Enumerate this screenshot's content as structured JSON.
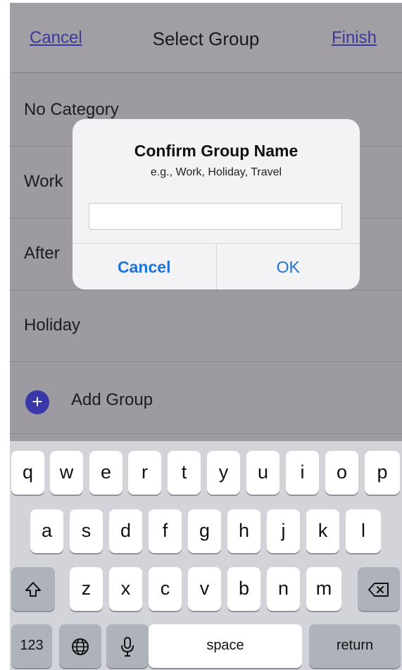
{
  "navbar": {
    "cancel_label": "Cancel",
    "title": "Select Group",
    "finish_label": "Finish"
  },
  "list": {
    "items": [
      {
        "label": "No Category"
      },
      {
        "label": "Work"
      },
      {
        "label": "After"
      },
      {
        "label": "Holiday"
      }
    ],
    "add_group_label": "Add Group",
    "add_icon": "plus-circle-icon"
  },
  "dialog": {
    "title": "Confirm Group Name",
    "subtitle": "e.g., Work, Holiday, Travel",
    "input_value": "",
    "cancel_label": "Cancel",
    "ok_label": "OK"
  },
  "keyboard": {
    "row1": [
      "q",
      "w",
      "e",
      "r",
      "t",
      "y",
      "u",
      "i",
      "o",
      "p"
    ],
    "row2": [
      "a",
      "s",
      "d",
      "f",
      "g",
      "h",
      "j",
      "k",
      "l"
    ],
    "row3": [
      "z",
      "x",
      "c",
      "v",
      "b",
      "n",
      "m"
    ],
    "numbers_label": "123",
    "space_label": "space",
    "return_label": "return",
    "shift_icon": "shift-icon",
    "backspace_icon": "backspace-icon",
    "globe_icon": "globe-icon",
    "mic_icon": "microphone-icon"
  },
  "colors": {
    "accent": "#1e73d8",
    "nav_link": "#3b3a9c",
    "add_button": "#3a37a8"
  }
}
